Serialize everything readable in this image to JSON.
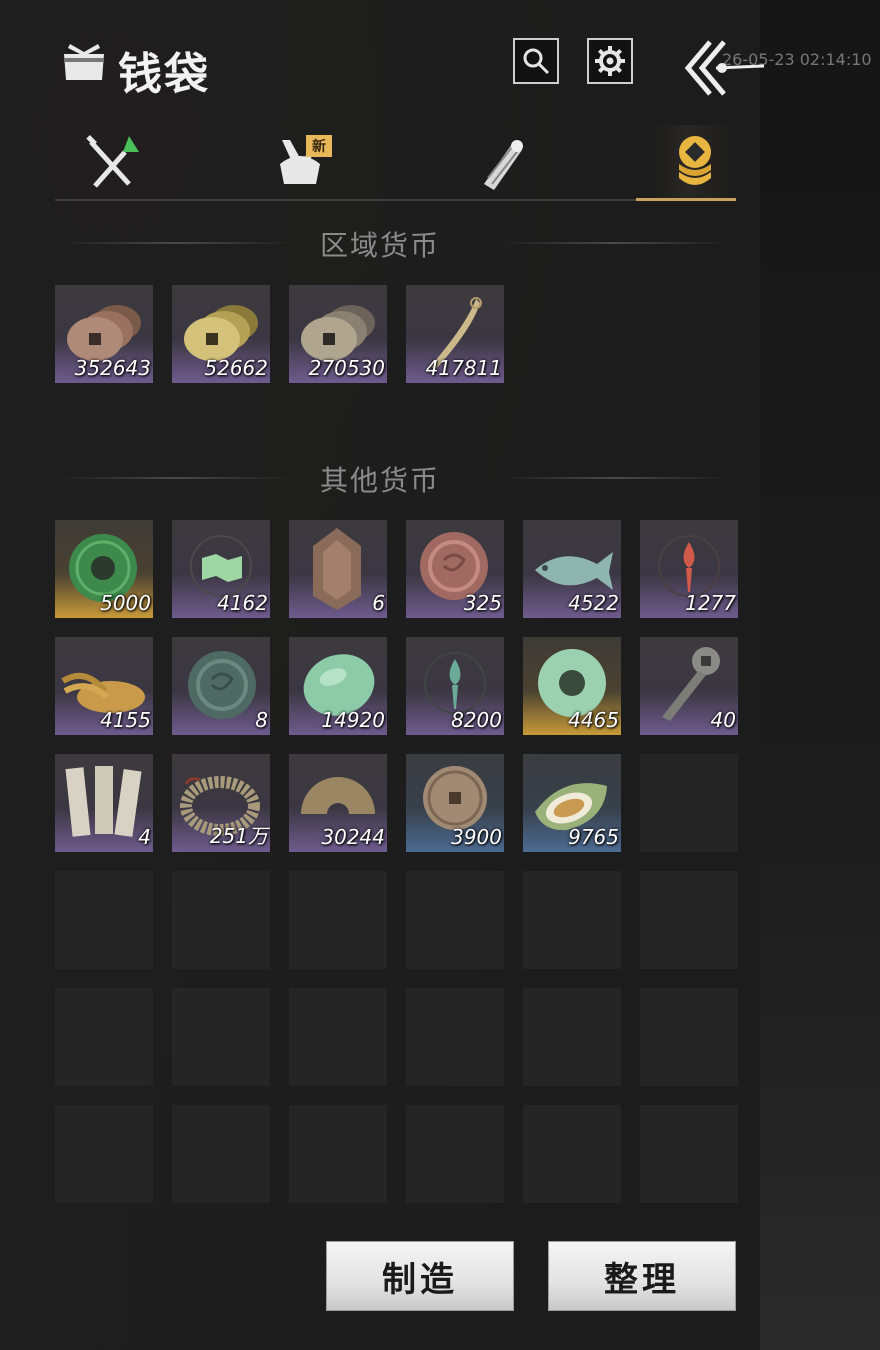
{
  "header": {
    "title": "钱袋",
    "clock": "26-05-23 02:14:10"
  },
  "tabs": [
    {
      "name": "weapons",
      "badge": ""
    },
    {
      "name": "bag",
      "badge": "新"
    },
    {
      "name": "scrolls",
      "badge": ""
    },
    {
      "name": "currency",
      "badge": ""
    }
  ],
  "sections": {
    "regional": "区域货币",
    "other": "其他货币"
  },
  "regional_items": [
    {
      "icon": "copper-coins-icon",
      "count": "352643",
      "tier": "purple"
    },
    {
      "icon": "gold-coins-icon",
      "count": "52662",
      "tier": "purple"
    },
    {
      "icon": "silver-coins-icon",
      "count": "270530",
      "tier": "purple"
    },
    {
      "icon": "blade-token-icon",
      "count": "417811",
      "tier": "purple"
    }
  ],
  "other_items": [
    {
      "icon": "jade-disc-icon",
      "count": "5000",
      "tier": "gold"
    },
    {
      "icon": "map-token-icon",
      "count": "4162",
      "tier": "purple"
    },
    {
      "icon": "bronze-plaque-icon",
      "count": "6",
      "tier": "purple"
    },
    {
      "icon": "red-coin-icon",
      "count": "325",
      "tier": "purple"
    },
    {
      "icon": "jade-fish-icon",
      "count": "4522",
      "tier": "purple"
    },
    {
      "icon": "red-emblem-icon",
      "count": "1277",
      "tier": "purple"
    },
    {
      "icon": "grain-pile-icon",
      "count": "4155",
      "tier": "purple"
    },
    {
      "icon": "stone-coin-icon",
      "count": "8",
      "tier": "purple"
    },
    {
      "icon": "jade-pebble-icon",
      "count": "14920",
      "tier": "purple"
    },
    {
      "icon": "green-emblem-icon",
      "count": "8200",
      "tier": "purple"
    },
    {
      "icon": "jade-ring-icon",
      "count": "4465",
      "tier": "gold"
    },
    {
      "icon": "key-coin-icon",
      "count": "40",
      "tier": "purple"
    },
    {
      "icon": "paper-notes-icon",
      "count": "4",
      "tier": "purple"
    },
    {
      "icon": "coin-string-icon",
      "count": "251万",
      "tier": "purple"
    },
    {
      "icon": "half-coin-icon",
      "count": "30244",
      "tier": "purple"
    },
    {
      "icon": "bronze-medal-icon",
      "count": "3900",
      "tier": "blue"
    },
    {
      "icon": "melon-icon",
      "count": "9765",
      "tier": "blue"
    }
  ],
  "buttons": {
    "craft": "制造",
    "sort": "整理"
  },
  "colors": {
    "accent": "#c8a25a",
    "purple_tier": "#6e5b8e",
    "gold_tier": "#c89a38",
    "blue_tier": "#4b6a92"
  }
}
